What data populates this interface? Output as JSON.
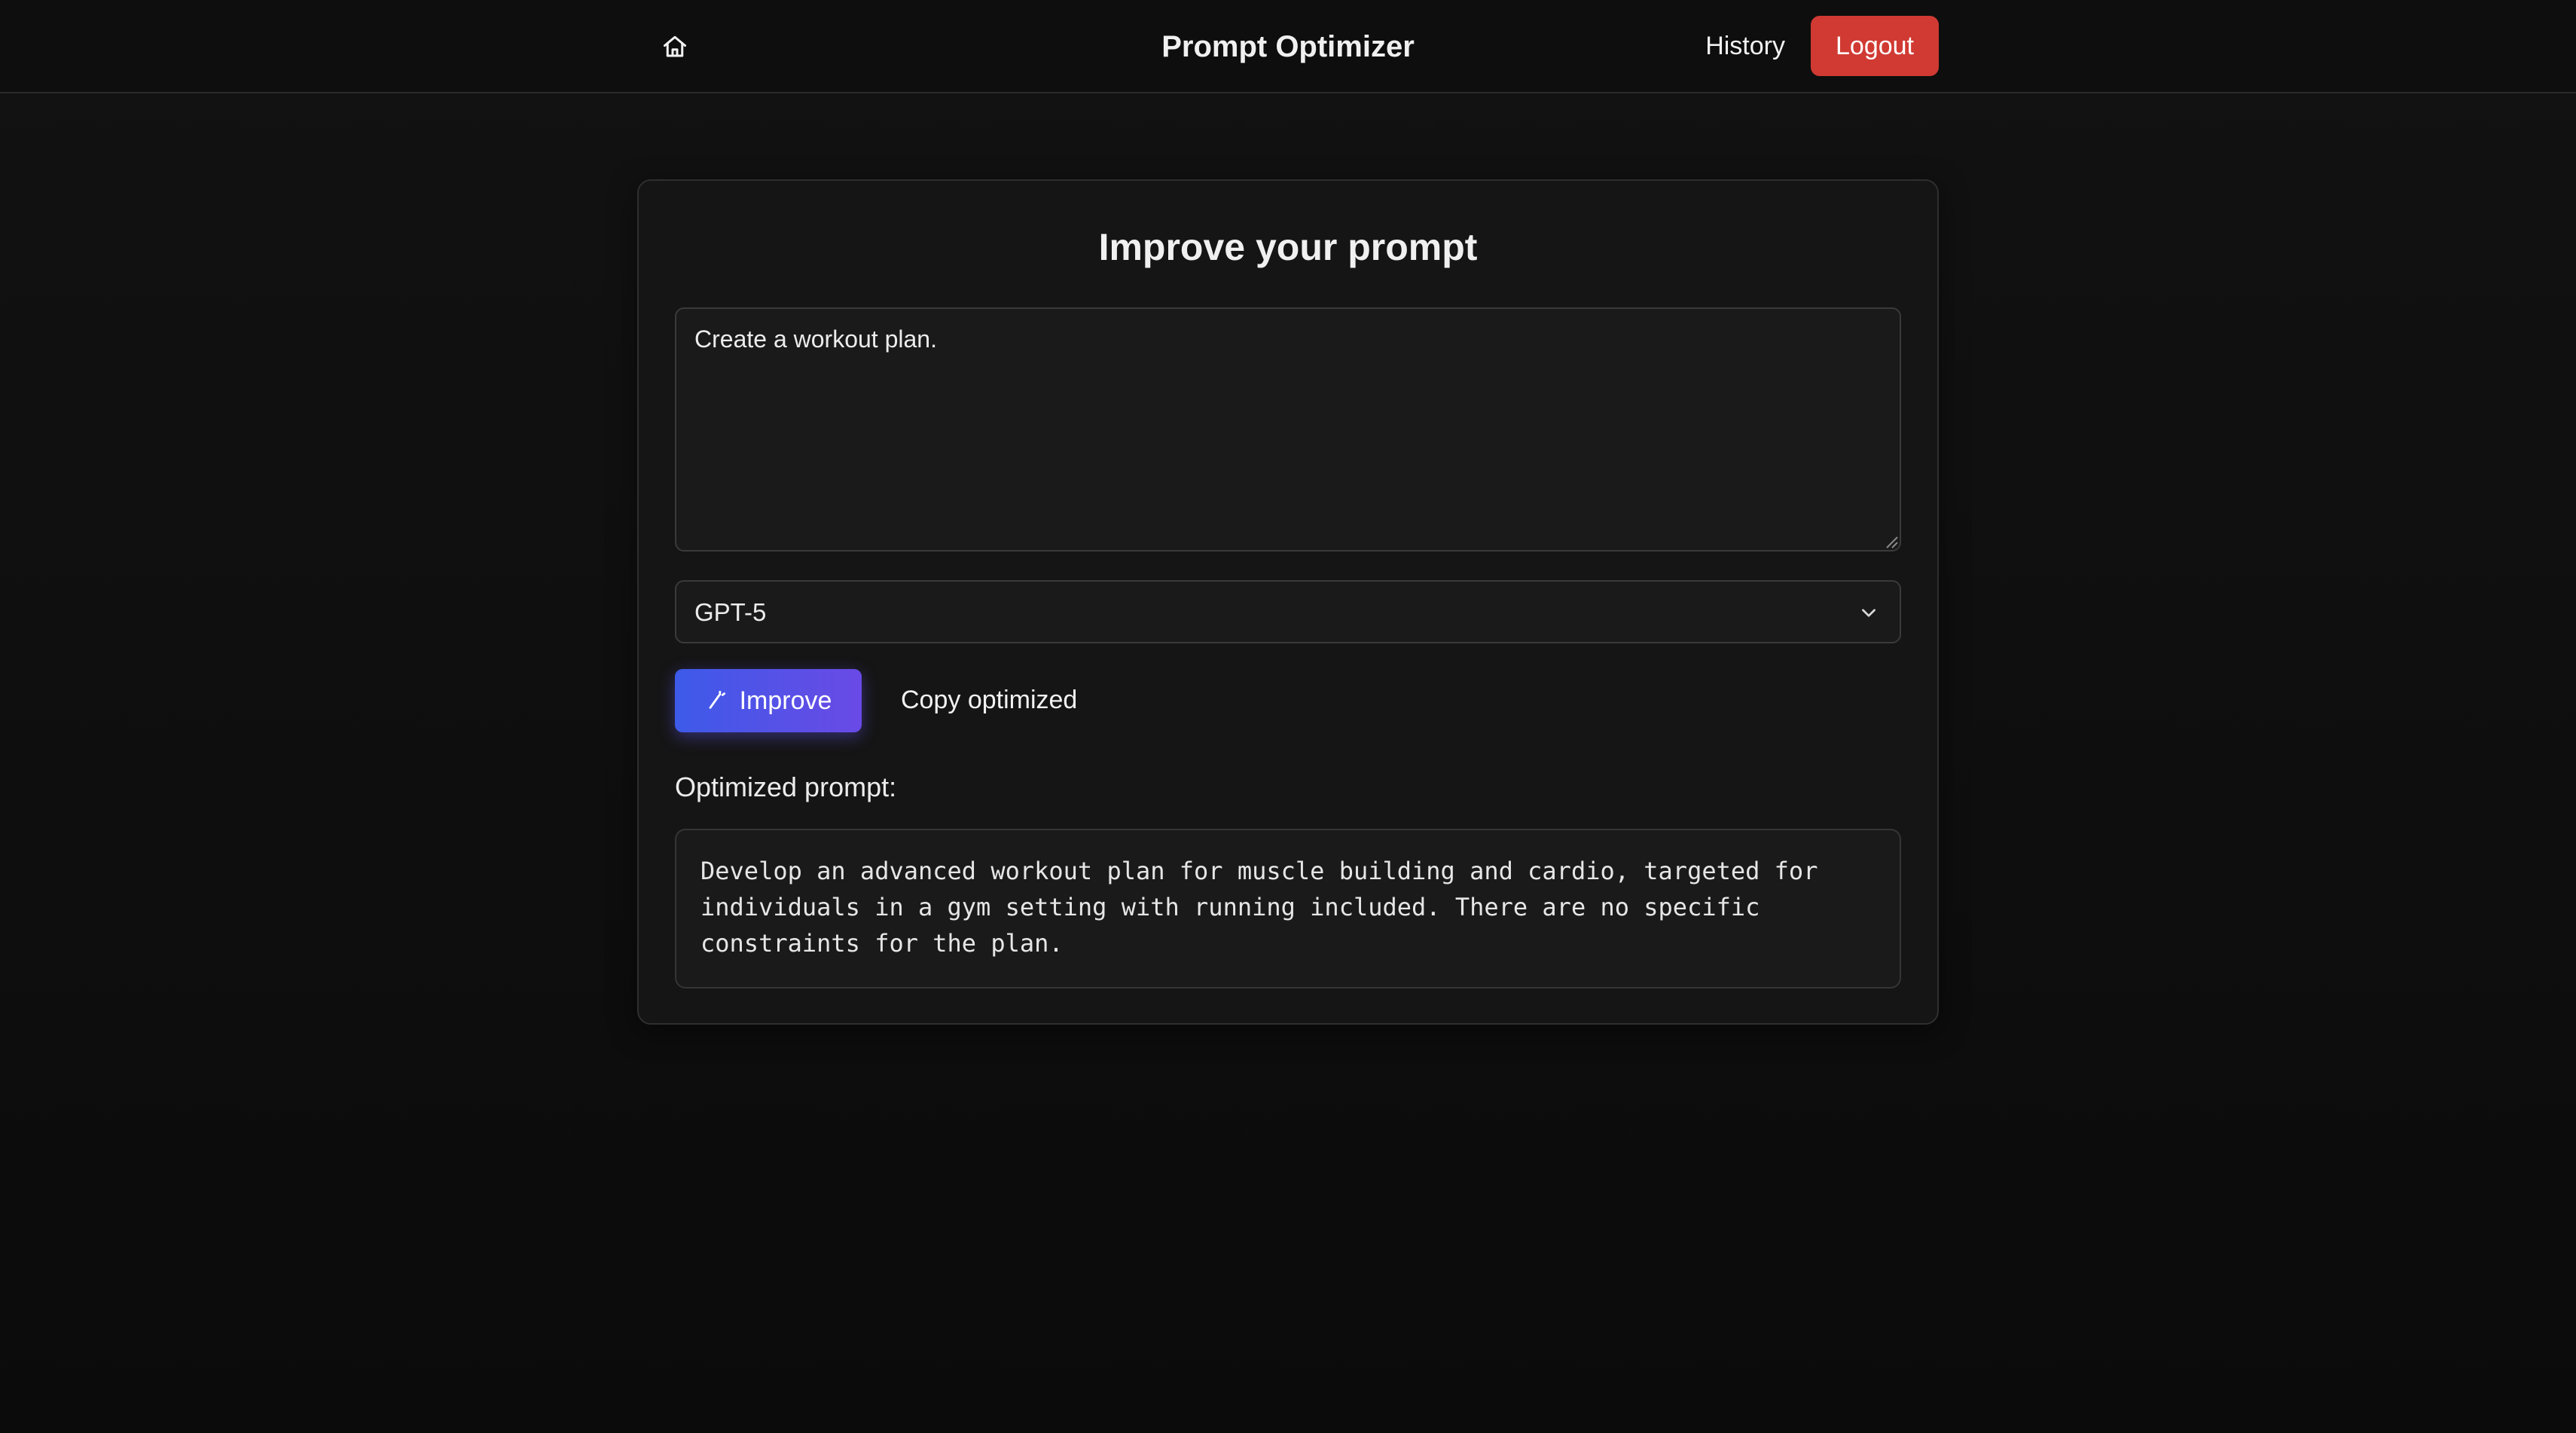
{
  "nav": {
    "home_icon": "home-icon",
    "title": "Prompt Optimizer",
    "history_label": "History",
    "logout_label": "Logout"
  },
  "card": {
    "title": "Improve your prompt",
    "prompt_value": "Create a workout plan.",
    "model": {
      "selected": "GPT-5",
      "icon": "chevron-down-icon"
    },
    "improve_label": "Improve",
    "improve_icon": "magic-wand-icon",
    "copy_label": "Copy optimized",
    "optimized_label": "Optimized prompt:",
    "optimized_text": "Develop an advanced workout plan for muscle building and cardio, targeted for individuals in a gym setting with running included. There are no specific constraints for the plan."
  },
  "colors": {
    "background": "#0e0e0e",
    "card": "#151515",
    "logout": "#d03a33",
    "improve_start": "#3d5ae8",
    "improve_end": "#6a4ae6"
  }
}
